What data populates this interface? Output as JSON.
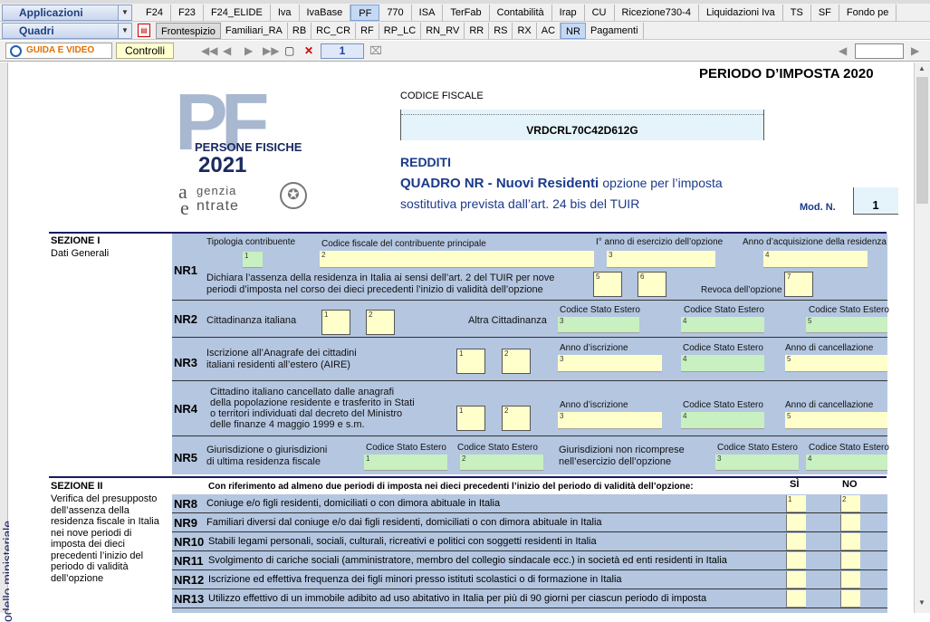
{
  "app_bar": {
    "combo1": "Applicazioni",
    "combo2": "Quadri",
    "tabs1": [
      "F24",
      "F23",
      "F24_ELIDE",
      "Iva",
      "IvaBase",
      "PF",
      "770",
      "ISA",
      "TerFab",
      "Contabilità",
      "Irap",
      "CU",
      "Ricezione730-4",
      "Liquidazioni Iva",
      "TS",
      "SF",
      "Fondo pe"
    ],
    "tabs1_selected": "PF",
    "tabs2": [
      "Frontespizio",
      "Familiari_RA",
      "RB",
      "RC_CR",
      "RF",
      "RP_LC",
      "RN_RV",
      "RR",
      "RS",
      "RX",
      "AC",
      "NR",
      "Pagamenti"
    ],
    "tabs2_selected": "NR"
  },
  "toolbar": {
    "guida": "GUIDA E VIDEO",
    "controlli": "Controlli",
    "page": "1"
  },
  "side_label": "odello ministeriale",
  "header": {
    "periodo": "PERIODO D’IMPOSTA 2020",
    "logo_pf": "PF",
    "logo_persone": "PERSONE FISICHE",
    "logo_year": "2021",
    "logo_agenzia": "genzia",
    "logo_entrate": "ntrate",
    "cf_label": "CODICE FISCALE",
    "cf_value": "VRDCRL70C42D612G",
    "redditi": "REDDITI",
    "quadro_title": "QUADRO NR - Nuovi Residenti",
    "quadro_sub1": "opzione per l’imposta",
    "quadro_sub2": "sostitutiva prevista dall’art. 24 bis del TUIR",
    "mod_label": "Mod. N.",
    "mod_value": "1"
  },
  "sez1": {
    "title": "SEZIONE I",
    "subtitle": "Dati Generali",
    "nr1": {
      "code": "NR1",
      "tipologia": "Tipologia contribuente",
      "cf_principale": "Codice fiscale del contribuente principale",
      "anno_esercizio": "I° anno di esercizio dell’opzione",
      "anno_acquisizione": "Anno d’acquisizione della residenza",
      "dichiara1": "Dichiara l’assenza della residenza in Italia ai sensi dell’art. 2 del TUIR per nove",
      "dichiara2": "periodi d’imposta nel corso dei dieci precedenti l’inizio di validità dell’opzione",
      "revoca": "Revoca dell’opzione"
    },
    "nr2": {
      "code": "NR2",
      "cittadinanza": "Cittadinanza italiana",
      "altra": "Altra Cittadinanza",
      "cse": "Codice Stato Estero"
    },
    "nr3": {
      "code": "NR3",
      "l1": "Iscrizione all’Anagrafe dei cittadini",
      "l2": "italiani residenti all’estero (AIRE)",
      "anno_iscrizione": "Anno d’iscrizione",
      "cse": "Codice Stato Estero",
      "anno_cancellazione": "Anno di cancellazione"
    },
    "nr4": {
      "code": "NR4",
      "l1": "Cittadino italiano cancellato dalle anagrafi",
      "l2": "della popolazione residente e trasferito in Stati",
      "l3": "o territori individuati dal decreto del Ministro",
      "l4": "delle finanze 4 maggio 1999 e s.m.",
      "anno_iscrizione": "Anno d’iscrizione",
      "cse": "Codice Stato Estero",
      "anno_cancellazione": "Anno di cancellazione"
    },
    "nr5": {
      "code": "NR5",
      "l1": "Giurisdizione o giurisdizioni",
      "l2": "di ultima residenza fiscale",
      "cse": "Codice Stato Estero",
      "non1": "Giurisdizioni non ricomprese",
      "non2": "nell’esercizio dell’opzione"
    }
  },
  "sez2": {
    "title": "SEZIONE II",
    "desc": [
      "Verifica del presupposto",
      "dell’assenza della",
      "residenza fiscale in Italia",
      "nei nove periodi di",
      "imposta dei dieci",
      "precedenti l’inizio del",
      "periodo di validità",
      "dell’opzione"
    ],
    "intro": "Con riferimento ad almeno due periodi di imposta nei dieci precedenti l’inizio del periodo di validità dell’opzione:",
    "si": "SÌ",
    "no": "NO",
    "rows": [
      {
        "code": "NR8",
        "text": "Coniuge e/o figli residenti, domiciliati o con dimora abituale in Italia"
      },
      {
        "code": "NR9",
        "text": "Familiari diversi dal coniuge e/o dai figli residenti, domiciliati o con dimora abituale in Italia"
      },
      {
        "code": "NR10",
        "text": "Stabili legami personali, sociali, culturali, ricreativi e politici con soggetti residenti in Italia"
      },
      {
        "code": "NR11",
        "text": "Svolgimento di cariche sociali (amministratore, membro del collegio sindacale ecc.) in società ed enti residenti in Italia"
      },
      {
        "code": "NR12",
        "text": "Iscrizione ed effettiva frequenza dei figli minori presso istituti scolastici o di formazione in Italia"
      },
      {
        "code": "NR13",
        "text": "Utilizzo effettivo di un immobile adibito ad uso abitativo in Italia per più di 90 giorni per ciascun periodo di imposta"
      }
    ]
  },
  "colors": {
    "accent": "#1f3f7f",
    "form_blue": "#b4c6e0",
    "field_yellow": "#ffffcc",
    "field_green": "#c8f0c0"
  }
}
